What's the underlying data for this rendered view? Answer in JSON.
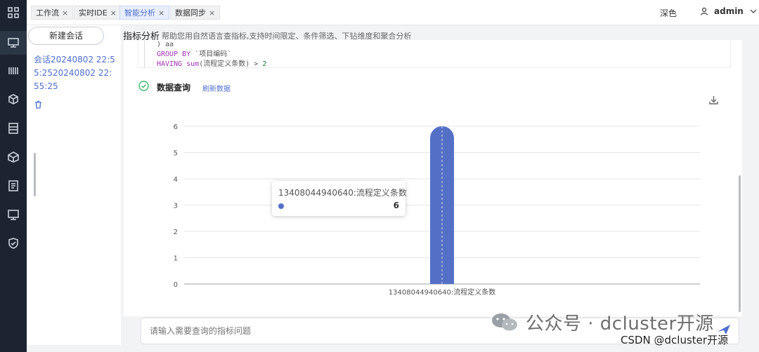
{
  "tabs": [
    {
      "label": "工作流",
      "active": false
    },
    {
      "label": "实时IDE",
      "active": false
    },
    {
      "label": "智能分析",
      "active": true
    },
    {
      "label": "数据同步",
      "active": false
    }
  ],
  "tab_close_glyph": "×",
  "header": {
    "theme_toggle": "深色",
    "user_name": "admin"
  },
  "sidebar_icons": [
    "apps-grid-icon",
    "monitor-icon",
    "barcode-icon",
    "cube-icon",
    "server-list-icon",
    "package-icon",
    "document-icon",
    "display-icon",
    "shield-check-icon"
  ],
  "sessions": {
    "new_button": "新建会话",
    "items": [
      {
        "title": "会话20240802 22:55:2520240802 22:55:25"
      }
    ]
  },
  "page": {
    "title": "指标分析",
    "description": "帮助您用自然语言查指标,支持时间限定、条件筛选、下钻维度和聚合分析"
  },
  "sql": {
    "line1_a": ") aa",
    "line2_kw": "GROUP BY",
    "line2_rest": " `项目编码`",
    "line3_kw": "HAVING",
    "line3_fn": " sum",
    "line3_rest": "(流程定义条数) > ",
    "line3_num": "2"
  },
  "step": {
    "title": "数据查询",
    "refresh_label": "刷新数据"
  },
  "chart_data": {
    "type": "bar",
    "categories": [
      "13408044940640:流程定义条数"
    ],
    "series": [
      {
        "values": [
          6
        ]
      }
    ],
    "ylim": [
      0,
      6
    ],
    "yticks": [
      0,
      1,
      2,
      3,
      4,
      5,
      6
    ],
    "grid": true,
    "bar_color": "#5470c6",
    "tooltip": {
      "title": "13408044940640:流程定义条数",
      "value": "6"
    }
  },
  "input": {
    "placeholder": "请输入需要查询的指标问题"
  },
  "watermark": {
    "main": "公众号 · dcluster开源",
    "sub": "CSDN @dcluster开源"
  }
}
